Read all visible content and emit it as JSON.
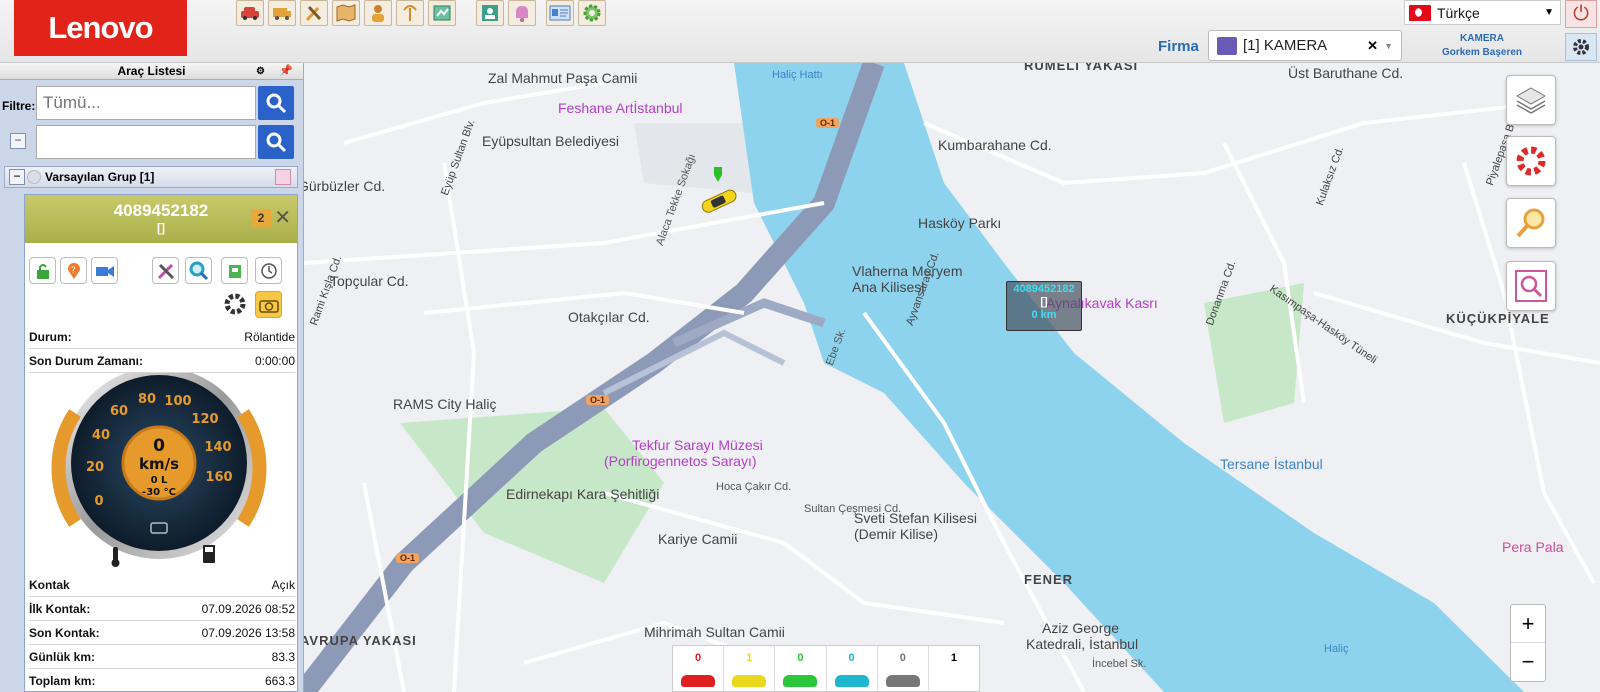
{
  "brand": "Lenovo",
  "toolbar_icons": [
    "car-icon",
    "vehicle-icon",
    "tools-icon",
    "map-icon",
    "person-icon",
    "signal-icon",
    "report-icon",
    "user-card-icon",
    "bell-icon",
    "id-card-icon",
    "settings-gear-icon"
  ],
  "language": {
    "value": "Türkçe"
  },
  "firma": {
    "label": "Firma",
    "value": "[1] KAMERA"
  },
  "user": {
    "company": "KAMERA",
    "name": "Gorkem Başeren"
  },
  "sidebar": {
    "title": "Araç Listesi",
    "filter_label": "Filtre:",
    "search1_placeholder": "Tümü...",
    "search2_value": "",
    "group": "Varsayılan Grup [1]"
  },
  "vehicle": {
    "plate": "4089452182",
    "subtitle": "[]",
    "badge": "2",
    "status_rows": [
      {
        "key": "Durum:",
        "value": "Rölantide"
      },
      {
        "key": "Son Durum Zamanı:",
        "value": "0:00:00"
      }
    ],
    "gauge": {
      "speed": "0",
      "unit": "km/s",
      "fuel": "0 L",
      "temp": "-30 °C"
    },
    "info_rows": [
      {
        "key": "Kontak",
        "value": "Açık"
      },
      {
        "key": "İlk Kontak:",
        "value": "07.09.2026 08:52"
      },
      {
        "key": "Son Kontak:",
        "value": "07.09.2026 13:58"
      },
      {
        "key": "Günlük km:",
        "value": "83.3"
      },
      {
        "key": "Toplam km:",
        "value": "663.3"
      }
    ]
  },
  "map_popup": {
    "plate": "4089452182",
    "sub": "[]",
    "km": "0 km"
  },
  "map_labels": [
    {
      "t": "Zal Mahmut Paşa Camii",
      "cls": ""
    },
    {
      "t": "Feshane Artİstanbul",
      "cls": "poi"
    },
    {
      "t": "Eyüpsultan Belediyesi",
      "cls": ""
    },
    {
      "t": "Haliç Hattı",
      "cls": "blue sm"
    },
    {
      "t": "RUMELİ YAKASI",
      "cls": "bold"
    },
    {
      "t": "Kumbarahane Cd.",
      "cls": ""
    },
    {
      "t": "Üst Baruthane Cd.",
      "cls": ""
    },
    {
      "t": "Hasköy Parkı",
      "cls": ""
    },
    {
      "t": "Vlaherna Meryem",
      "cls": ""
    },
    {
      "t": "Ana Kilisesi",
      "cls": ""
    },
    {
      "t": "Aynalıkavak Kasrı",
      "cls": "poi"
    },
    {
      "t": "KÜÇÜKPİYALE",
      "cls": "bold"
    },
    {
      "t": "Otakçılar Cd.",
      "cls": ""
    },
    {
      "t": "Topçular Cd.",
      "cls": ""
    },
    {
      "t": "Gürbüzler Cd.",
      "cls": ""
    },
    {
      "t": "RAMS City Haliç",
      "cls": ""
    },
    {
      "t": "Tekfur Sarayı Müzesi",
      "cls": "poi"
    },
    {
      "t": "(Porfirogennetos Sarayı)",
      "cls": "poi"
    },
    {
      "t": "Edirnekapı Kara Şehitliği",
      "cls": ""
    },
    {
      "t": "Kariye Camii",
      "cls": ""
    },
    {
      "t": "Sveti Stefan Kilisesi",
      "cls": ""
    },
    {
      "t": "(Demir Kilise)",
      "cls": ""
    },
    {
      "t": "Tersane İstanbul",
      "cls": "blue"
    },
    {
      "t": "FENER",
      "cls": "bold"
    },
    {
      "t": "Aziz George",
      "cls": ""
    },
    {
      "t": "Katedrali, İstanbul",
      "cls": ""
    },
    {
      "t": "Mihrimah Sultan Camii",
      "cls": ""
    },
    {
      "t": "AVRUPA YAKASI",
      "cls": "bold"
    },
    {
      "t": "Pera Pala",
      "cls": "pink"
    },
    {
      "t": "Ayvansaray Cd.",
      "cls": ""
    },
    {
      "t": "Kasımpaşa-Hasköy Tüneli",
      "cls": ""
    },
    {
      "t": "Donanma Cd.",
      "cls": ""
    },
    {
      "t": "Kulaksız Cd.",
      "cls": ""
    },
    {
      "t": "Piyalepaşa Blv.",
      "cls": ""
    },
    {
      "t": "Eyüp Sultan Blv.",
      "cls": ""
    },
    {
      "t": "Rami Kışla Cd.",
      "cls": ""
    },
    {
      "t": "Haliç",
      "cls": "blue sm"
    },
    {
      "t": "İncebel Sk.",
      "cls": "sm"
    },
    {
      "t": "Hoca Çakır Cd.",
      "cls": "sm"
    },
    {
      "t": "Sultan Çeşmesi Cd.",
      "cls": "sm"
    },
    {
      "t": "Ebe Sk.",
      "cls": "sm"
    },
    {
      "t": "Alaca Tekke Sokağı",
      "cls": "sm"
    },
    {
      "t": "O-1",
      "cls": "sm"
    },
    {
      "t": "O-1",
      "cls": "sm"
    },
    {
      "t": "O-1",
      "cls": "sm"
    }
  ],
  "map_controls": [
    "layers-icon",
    "map-settings-icon",
    "route-search-icon",
    "map-search-icon"
  ],
  "zoom": {
    "in": "+",
    "out": "−"
  },
  "status_counts": [
    {
      "count": "0",
      "color": "#e02020"
    },
    {
      "count": "1",
      "color": "#e9d81c"
    },
    {
      "count": "0",
      "color": "#2bc63b"
    },
    {
      "count": "0",
      "color": "#1fb7cf"
    },
    {
      "count": "0",
      "color": "#777777"
    },
    {
      "count": "1",
      "color": "#000000"
    }
  ]
}
